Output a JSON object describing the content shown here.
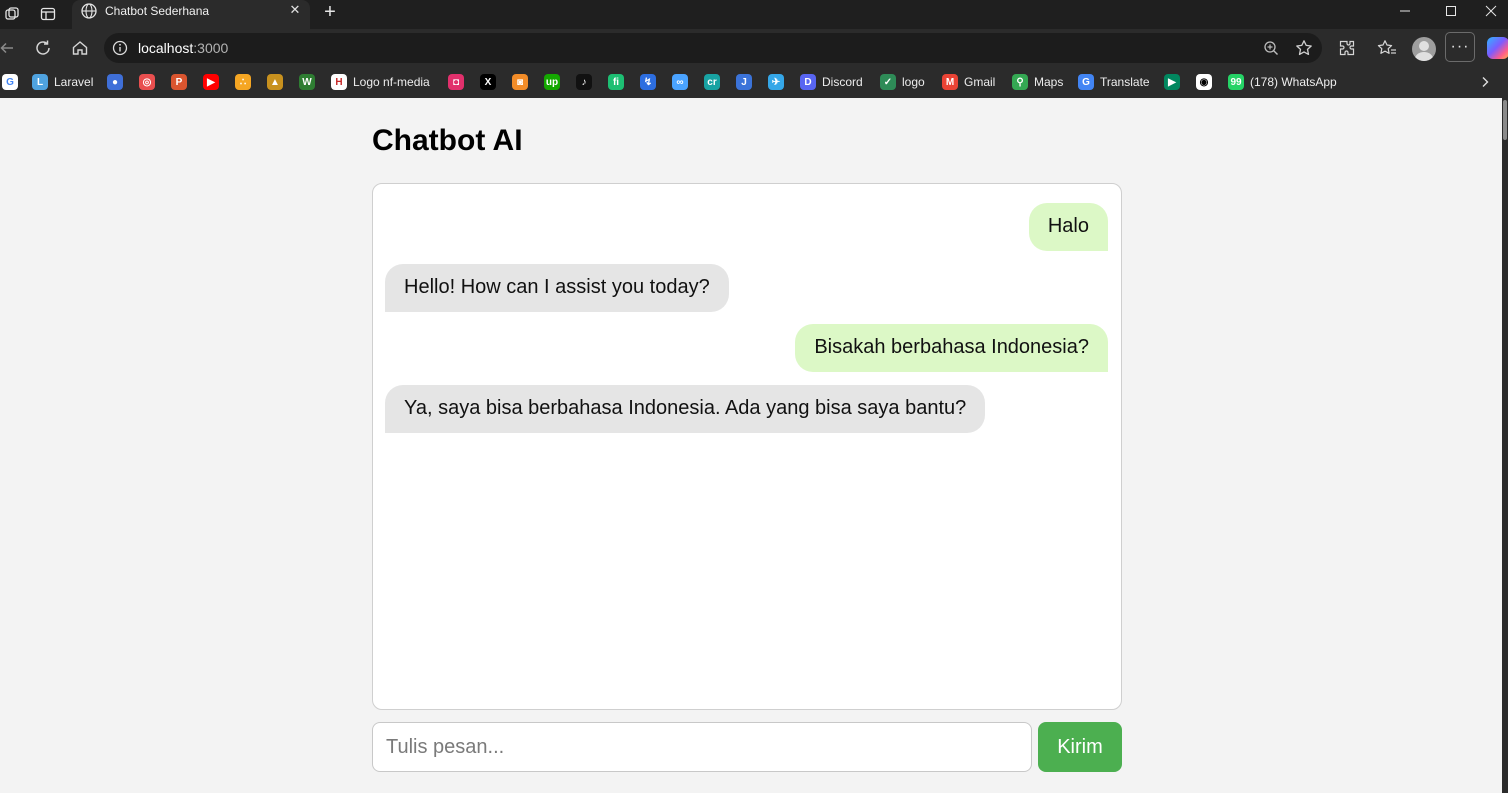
{
  "browser": {
    "tab_title": "Chatbot Sederhana",
    "new_tab_symbol": "+",
    "url_host": "localhost",
    "url_port": ":3000",
    "more_menu_symbol": "···",
    "icons": [
      "workspaces-icon",
      "tab-actions-icon",
      "globe-icon",
      "close-icon",
      "back-icon",
      "refresh-icon",
      "home-icon",
      "site-info-icon",
      "zoom-icon",
      "favorite-star-icon",
      "extensions-icon",
      "favorites-icon",
      "profile-avatar",
      "more-icon",
      "copilot-icon",
      "minimize-icon",
      "maximize-icon",
      "window-close-icon"
    ]
  },
  "bookmarks": [
    {
      "label": "",
      "icon": "google-icon",
      "color": "#ffffff"
    },
    {
      "label": "Laravel",
      "icon": "laravel-icon",
      "color": "#4fa3e0"
    },
    {
      "label": "",
      "icon": "site-icon-blue",
      "color": "#3f6fd8"
    },
    {
      "label": "",
      "icon": "site-icon-round",
      "color": "#e94f4f"
    },
    {
      "label": "",
      "icon": "product-hunt-icon",
      "color": "#da552f"
    },
    {
      "label": "",
      "icon": "youtube-icon",
      "color": "#ff0000"
    },
    {
      "label": "",
      "icon": "community-icon",
      "color": "#f5a623"
    },
    {
      "label": "",
      "icon": "temple-icon",
      "color": "#c8911e"
    },
    {
      "label": "",
      "icon": "w-icon",
      "color": "#2e7d32"
    },
    {
      "label": "Logo nf-media",
      "icon": "nf-media-icon",
      "color": "#ffffff"
    },
    {
      "label": "",
      "icon": "instagram-icon",
      "color": "#e1306c"
    },
    {
      "label": "",
      "icon": "x-icon",
      "color": "#000000"
    },
    {
      "label": "",
      "icon": "site-icon-orange",
      "color": "#f28c28"
    },
    {
      "label": "",
      "icon": "upwork-icon",
      "color": "#14a800"
    },
    {
      "label": "",
      "icon": "tiktok-icon",
      "color": "#111111"
    },
    {
      "label": "",
      "icon": "fiverr-icon",
      "color": "#1dbf73"
    },
    {
      "label": "",
      "icon": "site-icon-arrow",
      "color": "#2d6ee0"
    },
    {
      "label": "",
      "icon": "infinity-icon",
      "color": "#4aa3ff"
    },
    {
      "label": "",
      "icon": "site-icon-teal",
      "color": "#18a3a3"
    },
    {
      "label": "",
      "icon": "j-icon",
      "color": "#3b73d9"
    },
    {
      "label": "",
      "icon": "bird-icon",
      "color": "#35a7e8"
    },
    {
      "label": "Discord",
      "icon": "discord-icon",
      "color": "#5865f2"
    },
    {
      "label": "logo",
      "icon": "logo-icon",
      "color": "#2e8b57"
    },
    {
      "label": "Gmail",
      "icon": "gmail-icon",
      "color": "#ea4335"
    },
    {
      "label": "Maps",
      "icon": "maps-icon",
      "color": "#34a853"
    },
    {
      "label": "Translate",
      "icon": "translate-icon",
      "color": "#4285f4"
    },
    {
      "label": "",
      "icon": "play-store-icon",
      "color": "#01875f"
    },
    {
      "label": "",
      "icon": "github-icon",
      "color": "#ffffff"
    },
    {
      "label": "(178) WhatsApp",
      "icon": "whatsapp-icon",
      "color": "#25d366"
    }
  ],
  "app": {
    "title": "Chatbot AI",
    "input_placeholder": "Tulis pesan...",
    "send_label": "Kirim",
    "colors": {
      "user_bubble": "#dcf8c6",
      "bot_bubble": "#e5e5e5",
      "send_button": "#4caf50"
    }
  },
  "messages": [
    {
      "role": "user",
      "text": "Halo"
    },
    {
      "role": "bot",
      "text": "Hello! How can I assist you today?"
    },
    {
      "role": "user",
      "text": "Bisakah berbahasa Indonesia?"
    },
    {
      "role": "bot",
      "text": "Ya, saya bisa berbahasa Indonesia. Ada yang bisa saya bantu?"
    }
  ]
}
